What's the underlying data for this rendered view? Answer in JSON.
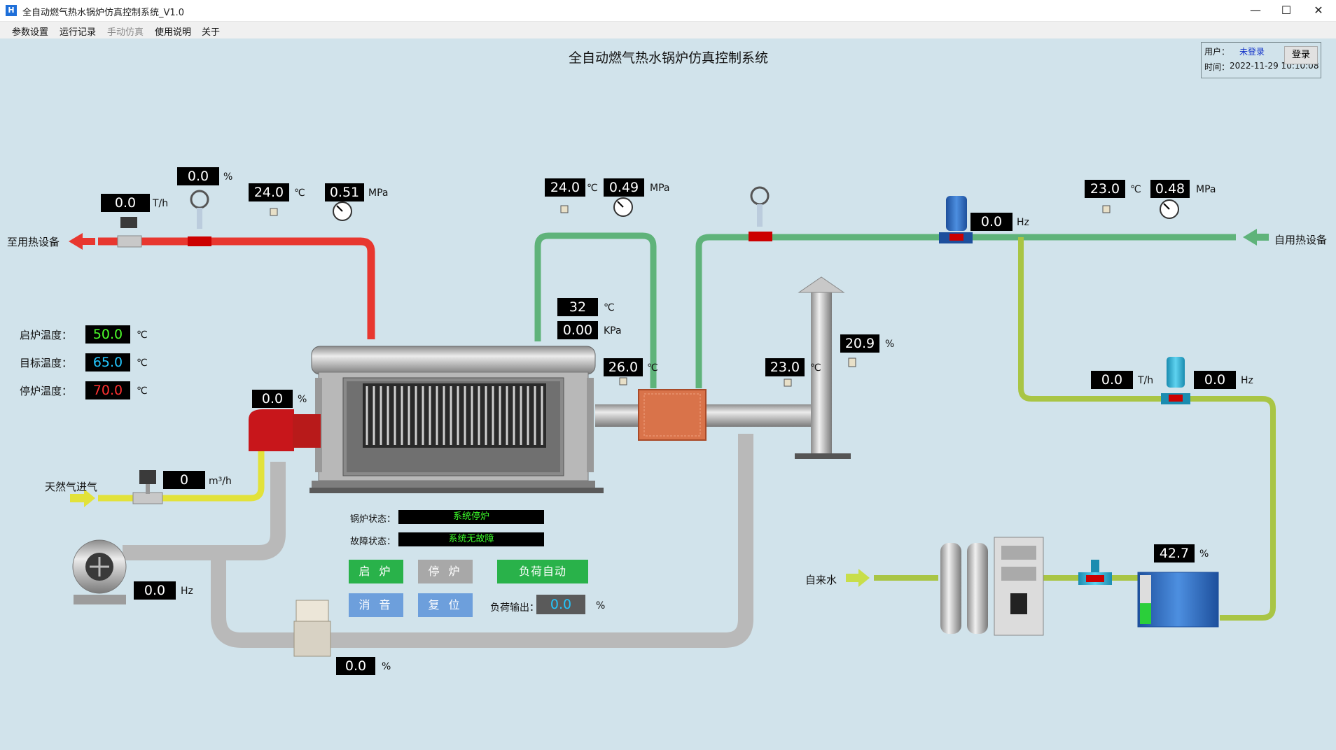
{
  "window": {
    "title": "全自动燃气热水锅炉仿真控制系统_V1.0",
    "minimize": "—",
    "maximize": "☐",
    "close": "✕"
  },
  "menu": [
    {
      "label": "参数设置",
      "enabled": true
    },
    {
      "label": "运行记录",
      "enabled": true
    },
    {
      "label": "手动仿真",
      "enabled": false
    },
    {
      "label": "使用说明",
      "enabled": true
    },
    {
      "label": "关于",
      "enabled": true
    }
  ],
  "header": {
    "title": "全自动燃气热水锅炉仿真控制系统"
  },
  "user": {
    "user_label": "用户：",
    "user_value": "未登录",
    "time_label": "时间：",
    "time_value": "2022-11-29 10:10:08",
    "login_label": "登录"
  },
  "labels": {
    "outlet": "至用热设备",
    "inlet": "自用热设备",
    "gas": "天然气进气",
    "tapwater": "自来水",
    "start_temp": "启炉温度：",
    "target_temp": "目标温度：",
    "stop_temp": "停炉温度：",
    "boiler_status": "锅炉状态：",
    "fault_status": "故障状态：",
    "load_output": "负荷输出："
  },
  "status": {
    "boiler": "系统停炉",
    "fault": "系统无故障"
  },
  "buttons": {
    "start": "启 炉",
    "stop": "停 炉",
    "load_auto": "负荷自动",
    "silence": "消 音",
    "reset": "复 位"
  },
  "readings": {
    "outlet_flow": "0.0",
    "outlet_flow_unit": "T/h",
    "outlet_valve": "0.0",
    "outlet_valve_unit": "%",
    "outlet_temp": "24.0",
    "outlet_temp_unit": "℃",
    "outlet_press": "0.51",
    "outlet_press_unit": "MPa",
    "return_temp": "24.0",
    "return_temp_unit": "℃",
    "return_press": "0.49",
    "return_press_unit": "MPa",
    "boiler_temp": "32",
    "boiler_temp_unit": "℃",
    "boiler_press": "0.00",
    "boiler_press_unit": "KPa",
    "flue_temp": "26.0",
    "flue_temp_unit": "℃",
    "chimney_temp": "23.0",
    "chimney_temp_unit": "℃",
    "oxygen": "20.9",
    "oxygen_unit": "%",
    "burner_valve": "0.0",
    "burner_valve_unit": "%",
    "gas_flow": "0",
    "gas_flow_unit": "m³/h",
    "fan_freq": "0.0",
    "fan_freq_unit": "Hz",
    "air_valve": "0.0",
    "air_valve_unit": "%",
    "circ_pump_freq": "0.0",
    "circ_pump_freq_unit": "Hz",
    "inlet_temp": "23.0",
    "inlet_temp_unit": "℃",
    "inlet_press": "0.48",
    "inlet_press_unit": "MPa",
    "makeup_flow": "0.0",
    "makeup_flow_unit": "T/h",
    "makeup_pump_freq": "0.0",
    "makeup_pump_freq_unit": "Hz",
    "tank_level": "42.7",
    "tank_level_unit": "%",
    "start_temp": "50.0",
    "target_temp": "65.0",
    "stop_temp": "70.0",
    "temp_unit": "℃",
    "load_output": "0.0",
    "load_output_unit": "%"
  },
  "colors": {
    "hot_pipe": "#e8372f",
    "return_pipe": "#5fb37a",
    "gas_pipe": "#e2e23a",
    "makeup_pipe": "#a9c544",
    "air_pipe": "#b9b9b9",
    "background": "#d1e3eb"
  }
}
